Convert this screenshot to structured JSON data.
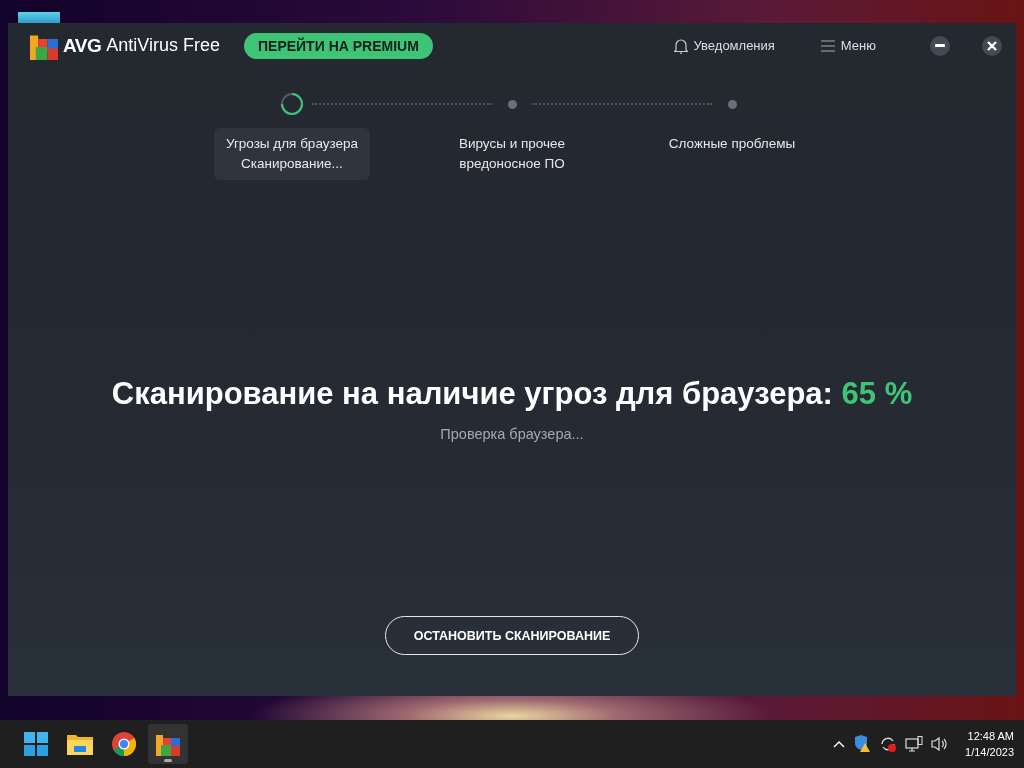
{
  "window": {
    "app_name": "AntiVirus Free",
    "brand": "AVG",
    "upgrade_button": "ПЕРЕЙТИ НА PREMIUM",
    "notifications": "Уведомления",
    "menu": "Меню"
  },
  "steps": [
    {
      "lines": [
        "Угрозы для браузера",
        "Сканирование..."
      ],
      "active": true
    },
    {
      "lines": [
        "Вирусы и прочее",
        "вредоносное ПО"
      ],
      "active": false
    },
    {
      "lines": [
        "Сложные проблемы"
      ],
      "active": false
    }
  ],
  "scan": {
    "title": "Сканирование на наличие угроз для браузера:",
    "percent": "65 %",
    "subtitle": "Проверка браузера...",
    "stop_button": "ОСТАНОВИТЬ СКАНИРОВАНИЕ"
  },
  "taskbar": {
    "apps": [
      {
        "kind": "start",
        "selected": false
      },
      {
        "kind": "folder",
        "selected": false
      },
      {
        "kind": "browser",
        "selected": false
      },
      {
        "kind": "avg",
        "selected": true
      }
    ],
    "time": "12:48 AM",
    "date": "1/14/2023"
  }
}
